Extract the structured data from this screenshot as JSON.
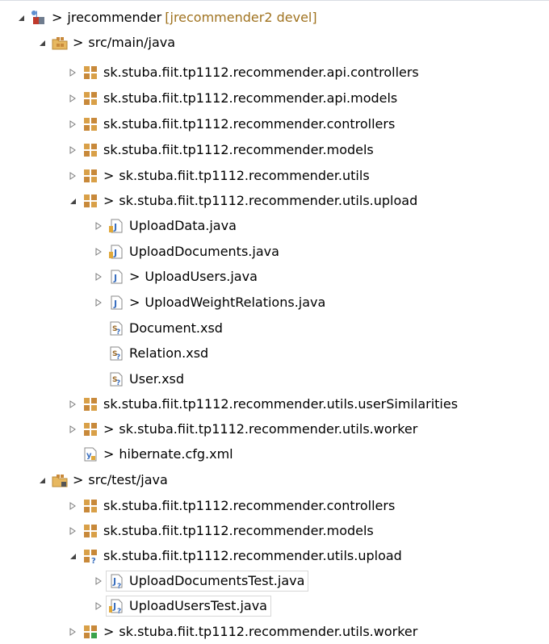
{
  "tree": {
    "project": {
      "name": "jrecommender",
      "decoration": "[jrecommender2 devel]",
      "dirty": ">"
    },
    "src_main": {
      "name": "src/main/java",
      "dirty": ">"
    },
    "main_packages": [
      {
        "name": "sk.stuba.fiit.tp1112.recommender.api.controllers",
        "dirty": ""
      },
      {
        "name": "sk.stuba.fiit.tp1112.recommender.api.models",
        "dirty": ""
      },
      {
        "name": "sk.stuba.fiit.tp1112.recommender.controllers",
        "dirty": ""
      },
      {
        "name": "sk.stuba.fiit.tp1112.recommender.models",
        "dirty": ""
      },
      {
        "name": "sk.stuba.fiit.tp1112.recommender.utils",
        "dirty": ">"
      },
      {
        "name": "sk.stuba.fiit.tp1112.recommender.utils.upload",
        "dirty": ">"
      }
    ],
    "upload_files": [
      {
        "name": "UploadData.java",
        "dirty": ""
      },
      {
        "name": "UploadDocuments.java",
        "dirty": ""
      },
      {
        "name": "UploadUsers.java",
        "dirty": ">"
      },
      {
        "name": "UploadWeightRelations.java",
        "dirty": ">"
      },
      {
        "name": "Document.xsd",
        "dirty": ""
      },
      {
        "name": "Relation.xsd",
        "dirty": ""
      },
      {
        "name": "User.xsd",
        "dirty": ""
      }
    ],
    "main_packages_after": [
      {
        "name": "sk.stuba.fiit.tp1112.recommender.utils.userSimilarities",
        "dirty": ""
      },
      {
        "name": "sk.stuba.fiit.tp1112.recommender.utils.worker",
        "dirty": ">"
      }
    ],
    "hibernate": {
      "name": "hibernate.cfg.xml",
      "dirty": ">"
    },
    "src_test": {
      "name": "src/test/java",
      "dirty": ">"
    },
    "test_packages": [
      {
        "name": "sk.stuba.fiit.tp1112.recommender.controllers",
        "dirty": ""
      },
      {
        "name": "sk.stuba.fiit.tp1112.recommender.models",
        "dirty": ""
      },
      {
        "name": "sk.stuba.fiit.tp1112.recommender.utils.upload",
        "dirty": ""
      }
    ],
    "test_files": [
      {
        "name": "UploadDocumentsTest.java",
        "dirty": ""
      },
      {
        "name": "UploadUsersTest.java",
        "dirty": ""
      }
    ],
    "test_packages_after": [
      {
        "name": "sk.stuba.fiit.tp1112.recommender.utils.worker",
        "dirty": ">"
      }
    ]
  },
  "icons": {
    "expanded": "triangle-down-icon",
    "collapsed": "triangle-right-icon",
    "project": "java-project-icon",
    "source_folder": "source-folder-icon",
    "package": "package-icon",
    "java_file": "java-file-icon",
    "xsd_file": "xsd-file-icon",
    "xml_file": "xml-file-icon"
  },
  "colors": {
    "decoration": "#a07320",
    "package_brown": "#c8893a",
    "java_blue": "#3a6fbf",
    "twistie": "#7a7a7a"
  }
}
